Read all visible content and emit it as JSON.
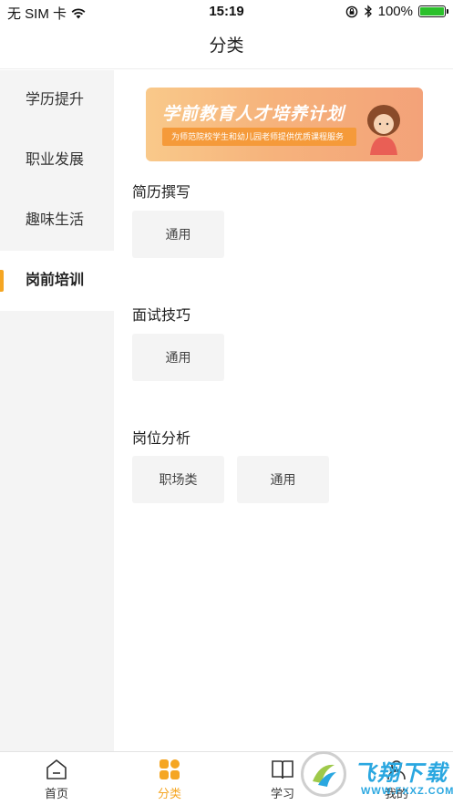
{
  "status_bar": {
    "carrier": "无 SIM 卡",
    "time": "15:19",
    "battery_percent": "100%",
    "battery_level": 1.0,
    "icons": [
      "wifi-icon",
      "orientation-lock-icon",
      "bluetooth-icon",
      "battery-icon"
    ]
  },
  "nav": {
    "title": "分类"
  },
  "sidebar": {
    "items": [
      {
        "label": "学历提升"
      },
      {
        "label": "职业发展"
      },
      {
        "label": "趣味生活"
      },
      {
        "label": "岗前培训"
      }
    ],
    "active_index": 3
  },
  "banner": {
    "title": "学前教育人才培养计划",
    "subtitle": "为师范院校学生和幼儿园老师提供优质课程服务"
  },
  "sections": [
    {
      "title": "简历撰写",
      "tags": [
        "通用"
      ]
    },
    {
      "title": "面试技巧",
      "tags": [
        "通用"
      ]
    },
    {
      "title": "岗位分析",
      "tags": [
        "职场类",
        "通用"
      ]
    }
  ],
  "tabbar": {
    "items": [
      {
        "label": "首页",
        "icon": "home-icon"
      },
      {
        "label": "分类",
        "icon": "category-icon"
      },
      {
        "label": "学习",
        "icon": "book-icon"
      },
      {
        "label": "我的",
        "icon": "profile-icon"
      }
    ],
    "active_index": 1
  },
  "watermark": {
    "text": "飞翔下载",
    "url": "WWW.FXXZ.COM"
  },
  "colors": {
    "accent": "#f5a623",
    "sidebar_bg": "#f4f4f4",
    "tag_bg": "#f4f4f4",
    "battery": "#2bc02b"
  }
}
